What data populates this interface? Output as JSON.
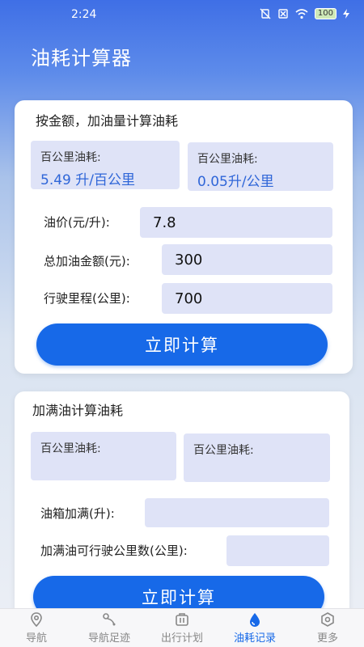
{
  "status": {
    "time": "2:24",
    "battery": "100"
  },
  "app": {
    "title": "油耗计算器"
  },
  "card1": {
    "title": "按金额，加油量计算油耗",
    "result1": {
      "label": "百公里油耗:",
      "value": "5.49 升/百公里"
    },
    "result2": {
      "label": "百公里油耗:",
      "value": "0.05升/公里"
    },
    "price": {
      "label": "油价(元/升):",
      "value": "7.8"
    },
    "amount": {
      "label": "总加油金额(元):",
      "value": "300"
    },
    "distance": {
      "label": "行驶里程(公里):",
      "value": "700"
    },
    "button": "立即计算"
  },
  "card2": {
    "title": "加满油计算油耗",
    "result1": {
      "label": "百公里油耗:",
      "value": ""
    },
    "result2": {
      "label": "百公里油耗:",
      "value": ""
    },
    "tank": {
      "label": "油箱加满(升):",
      "value": ""
    },
    "range": {
      "label": "加满油可行驶公里数(公里):",
      "value": ""
    },
    "button": "立即计算"
  },
  "tabs": [
    {
      "label": "导航",
      "icon": "location-pin-icon"
    },
    {
      "label": "导航足迹",
      "icon": "footprint-icon"
    },
    {
      "label": "出行计划",
      "icon": "luggage-icon"
    },
    {
      "label": "油耗记录",
      "icon": "fuel-drop-icon"
    },
    {
      "label": "更多",
      "icon": "hexagon-icon"
    }
  ],
  "colors": {
    "accent": "#1769e8",
    "field_bg": "#dfe3f7",
    "value_blue": "#2f66d8"
  }
}
